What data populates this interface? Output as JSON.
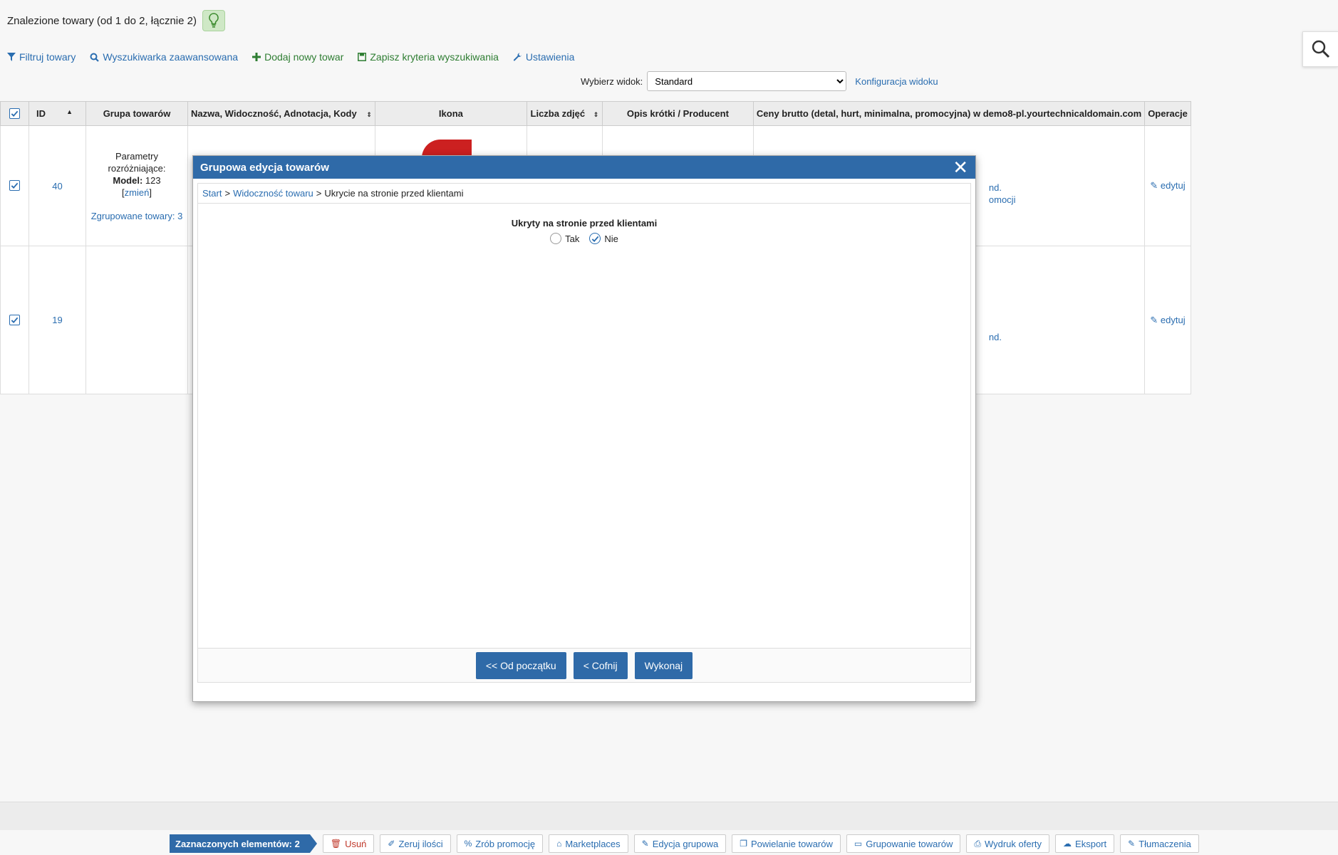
{
  "header": {
    "title": "Znalezione towary (od 1 do 2, łącznie 2)",
    "bulb_icon": "lightbulb-icon"
  },
  "toolbar": {
    "filter": "Filtruj towary",
    "advanced_search": "Wyszukiwarka zaawansowana",
    "add_new": "Dodaj nowy towar",
    "save_criteria": "Zapisz kryteria wyszukiwania",
    "settings": "Ustawienia"
  },
  "view": {
    "label": "Wybierz widok:",
    "selected": "Standard",
    "config_link": "Konfiguracja widoku"
  },
  "table": {
    "headers": {
      "id": "ID",
      "group": "Grupa towarów",
      "name": "Nazwa, Widoczność, Adnotacja, Kody",
      "icon": "Ikona",
      "photos": "Liczba zdjęć",
      "desc": "Opis krótki / Producent",
      "prices": "Ceny brutto (detal, hurt, minimalna, promocyjna) w demo8-pl.yourtechnicaldomain.com",
      "ops": "Operacje"
    },
    "rows": [
      {
        "id": "40",
        "group_params_label": "Parametry rozróżniające:",
        "group_model_label": "Model:",
        "group_model_value": "123",
        "group_change_link": "zmień",
        "group_grouped": "Zgrupowane towary: 3",
        "price_fragment_1": "nd.",
        "price_fragment_2": "omocji",
        "edit": "edytuj"
      },
      {
        "id": "19",
        "price_fragment_1": "nd.",
        "edit": "edytuj"
      }
    ]
  },
  "dialog": {
    "title": "Grupowa edycja towarów",
    "breadcrumb": {
      "start": "Start",
      "sep": ">",
      "visibility": "Widoczność towaru",
      "current": "Ukrycie na stronie przed klientami"
    },
    "field_label": "Ukryty na stronie przed klientami",
    "option_yes": "Tak",
    "option_no": "Nie",
    "selected_option": "Nie",
    "btn_first": "<< Od początku",
    "btn_back": "< Cofnij",
    "btn_execute": "Wykonaj"
  },
  "bottom": {
    "selected_count": "Zaznaczonych elementów: 2",
    "buttons": {
      "delete": "Usuń",
      "reset_qty": "Zeruj ilości",
      "promo": "Zrób promocję",
      "marketplaces": "Marketplaces",
      "group_edit": "Edycja grupowa",
      "duplicate": "Powielanie towarów",
      "grouping": "Grupowanie towarów",
      "print_offer": "Wydruk oferty",
      "export": "Eksport",
      "translations": "Tłumaczenia"
    }
  },
  "colors": {
    "primary": "#2f6aa8",
    "link": "#2a6db0",
    "green": "#2e7d32",
    "danger": "#c0392b"
  }
}
